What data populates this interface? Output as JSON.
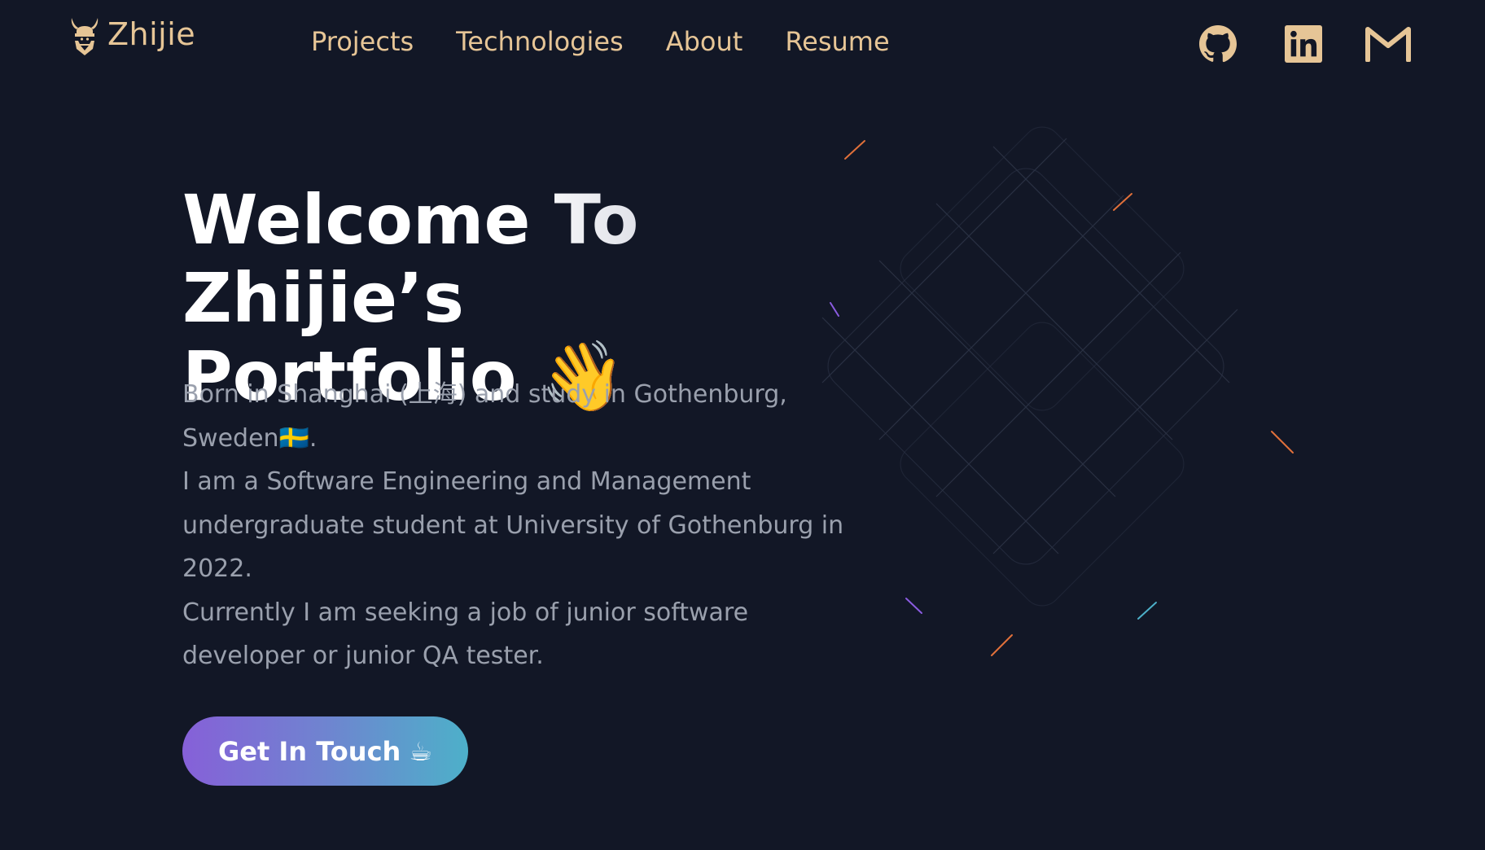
{
  "brand": {
    "name": "Zhijie",
    "logo_icon": "viking-helmet-icon",
    "color": "#e6c596"
  },
  "nav": {
    "items": [
      {
        "label": "Projects"
      },
      {
        "label": "Technologies"
      },
      {
        "label": "About"
      },
      {
        "label": "Resume"
      }
    ]
  },
  "social": {
    "github_icon": "github-icon",
    "linkedin_icon": "linkedin-icon",
    "mail_icon": "gmail-icon"
  },
  "hero": {
    "title_line1": "Welcome To Zhijie’s",
    "title_line2": "Portfolio",
    "title_emoji": "👋",
    "description": [
      "Born in Shanghai (上海) and study in Gothenburg, Sweden🇸🇪.",
      "I am a Software Engineering and Management undergraduate student at University of Gothenburg in 2022.",
      "Currently I am seeking a job of junior software developer or junior QA tester."
    ],
    "cta_label": "Get In Touch",
    "cta_emoji": "☕"
  },
  "colors": {
    "background": "#121726",
    "accent": "#e6c596",
    "text_muted": "#9aa0ad",
    "cta_gradient_start": "#8660d8",
    "cta_gradient_end": "#4db0c9"
  }
}
